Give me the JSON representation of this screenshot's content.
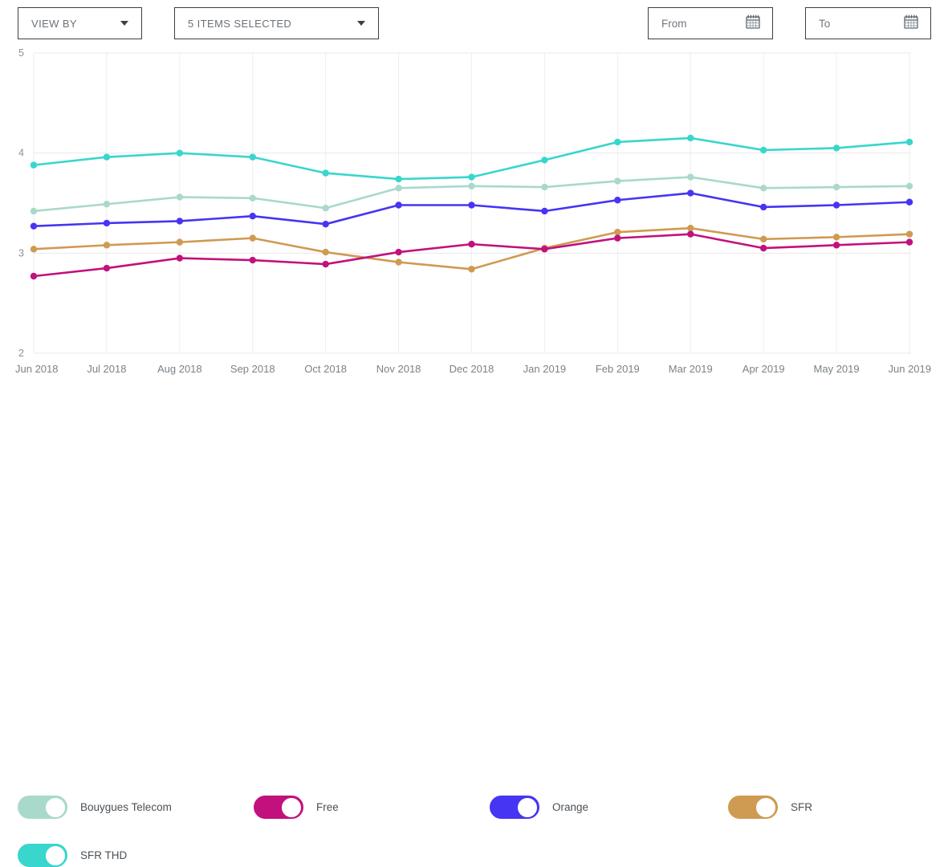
{
  "toolbar": {
    "view_by": {
      "label": "VIEW BY",
      "icon": "chevron-down-icon"
    },
    "items_selected": {
      "label": "5 ITEMS SELECTED",
      "icon": "chevron-down-icon"
    },
    "from_date": {
      "placeholder": "From",
      "value": "",
      "icon": "calendar-icon"
    },
    "to_date": {
      "placeholder": "To",
      "value": "",
      "icon": "calendar-icon"
    }
  },
  "legend": [
    {
      "label": "Bouygues Telecom",
      "color": "#a9d9cb",
      "on": true
    },
    {
      "label": "Free",
      "color": "#c2117c",
      "on": true
    },
    {
      "label": "Orange",
      "color": "#4635f2",
      "on": true
    },
    {
      "label": "SFR",
      "color": "#cf9a51",
      "on": true
    },
    {
      "label": "SFR THD",
      "color": "#38d6cd",
      "on": true
    }
  ],
  "chart_data": {
    "type": "line",
    "title": "",
    "xlabel": "",
    "ylabel": "",
    "ylim": [
      2,
      5
    ],
    "yticks": [
      2,
      3,
      4,
      5
    ],
    "grid": true,
    "legend_position": "bottom",
    "categories": [
      "Jun 2018",
      "Jul 2018",
      "Aug 2018",
      "Sep 2018",
      "Oct 2018",
      "Nov 2018",
      "Dec 2018",
      "Jan 2019",
      "Feb 2019",
      "Mar 2019",
      "Apr 2019",
      "May 2019",
      "Jun 2019"
    ],
    "series": [
      {
        "name": "SFR THD",
        "color": "#38d6cd",
        "values": [
          3.88,
          3.96,
          4.0,
          3.96,
          3.8,
          3.74,
          3.76,
          3.93,
          4.11,
          4.15,
          4.03,
          4.05,
          4.11
        ]
      },
      {
        "name": "Bouygues Telecom",
        "color": "#a9d9cb",
        "values": [
          3.42,
          3.49,
          3.56,
          3.55,
          3.45,
          3.65,
          3.67,
          3.66,
          3.72,
          3.76,
          3.65,
          3.66,
          3.67
        ]
      },
      {
        "name": "Orange",
        "color": "#4635f2",
        "values": [
          3.27,
          3.3,
          3.32,
          3.37,
          3.29,
          3.48,
          3.48,
          3.42,
          3.53,
          3.6,
          3.46,
          3.48,
          3.51
        ]
      },
      {
        "name": "SFR",
        "color": "#cf9a51",
        "values": [
          3.04,
          3.08,
          3.11,
          3.15,
          3.01,
          2.91,
          2.84,
          3.05,
          3.21,
          3.25,
          3.14,
          3.16,
          3.19
        ]
      },
      {
        "name": "Free",
        "color": "#c2117c",
        "values": [
          2.77,
          2.85,
          2.95,
          2.93,
          2.89,
          3.01,
          3.09,
          3.04,
          3.15,
          3.19,
          3.05,
          3.08,
          3.11
        ]
      }
    ]
  }
}
